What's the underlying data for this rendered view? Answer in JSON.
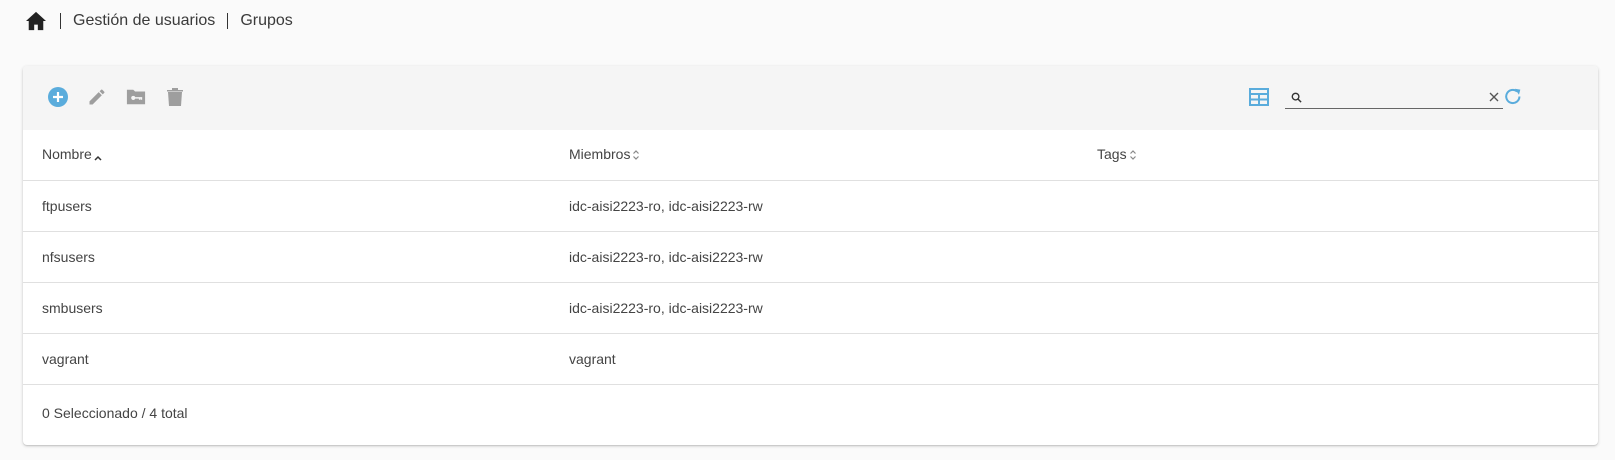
{
  "breadcrumb": {
    "home_icon": "home-icon",
    "items": [
      "Gestión de usuarios",
      "Grupos"
    ]
  },
  "toolbar": {
    "icons": [
      "add-circle-icon",
      "edit-icon",
      "folder-key-icon",
      "delete-icon",
      "table-columns-icon",
      "search-icon",
      "clear-icon",
      "refresh-icon"
    ],
    "search": {
      "value": "",
      "placeholder": ""
    },
    "accent_color": "#5aacdc",
    "disabled_color": "#9e9e9e"
  },
  "table": {
    "columns": [
      {
        "label": "Nombre",
        "sort": "ascending"
      },
      {
        "label": "Miembros",
        "sort": "none"
      },
      {
        "label": "Tags",
        "sort": "none"
      }
    ],
    "rows": [
      {
        "name": "ftpusers",
        "members": "idc-aisi2223-ro, idc-aisi2223-rw",
        "tags": ""
      },
      {
        "name": "nfsusers",
        "members": "idc-aisi2223-ro, idc-aisi2223-rw",
        "tags": ""
      },
      {
        "name": "smbusers",
        "members": "idc-aisi2223-ro, idc-aisi2223-rw",
        "tags": ""
      },
      {
        "name": "vagrant",
        "members": "vagrant",
        "tags": ""
      }
    ]
  },
  "footer": {
    "selection_text": "0 Seleccionado / 4 total"
  }
}
